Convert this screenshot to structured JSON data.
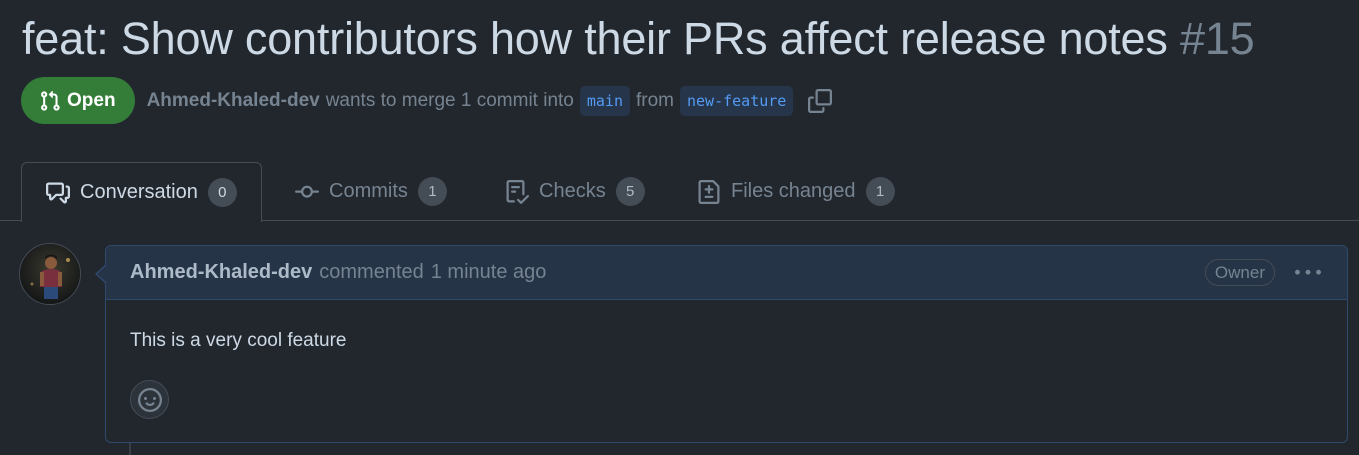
{
  "pr": {
    "title": "feat: Show contributors how their PRs affect release notes",
    "number": "#15",
    "state": "Open",
    "author": "Ahmed-Khaled-dev",
    "merge_text": "wants to merge 1 commit into",
    "base_branch": "main",
    "from_text": "from",
    "head_branch": "new-feature"
  },
  "tabs": [
    {
      "label": "Conversation",
      "count": "0",
      "icon": "comment-discussion-icon",
      "active": true
    },
    {
      "label": "Commits",
      "count": "1",
      "icon": "git-commit-icon",
      "active": false
    },
    {
      "label": "Checks",
      "count": "5",
      "icon": "checklist-icon",
      "active": false
    },
    {
      "label": "Files changed",
      "count": "1",
      "icon": "file-diff-icon",
      "active": false
    }
  ],
  "comment": {
    "author": "Ahmed-Khaled-dev",
    "action": "commented",
    "time": "1 minute ago",
    "role": "Owner",
    "body": "This is a very cool feature"
  },
  "colors": {
    "background": "#22272e",
    "open_green": "#347d39",
    "branch_blue": "#539bf5",
    "comment_header": "#263448",
    "comment_border": "#2f4a6e"
  }
}
